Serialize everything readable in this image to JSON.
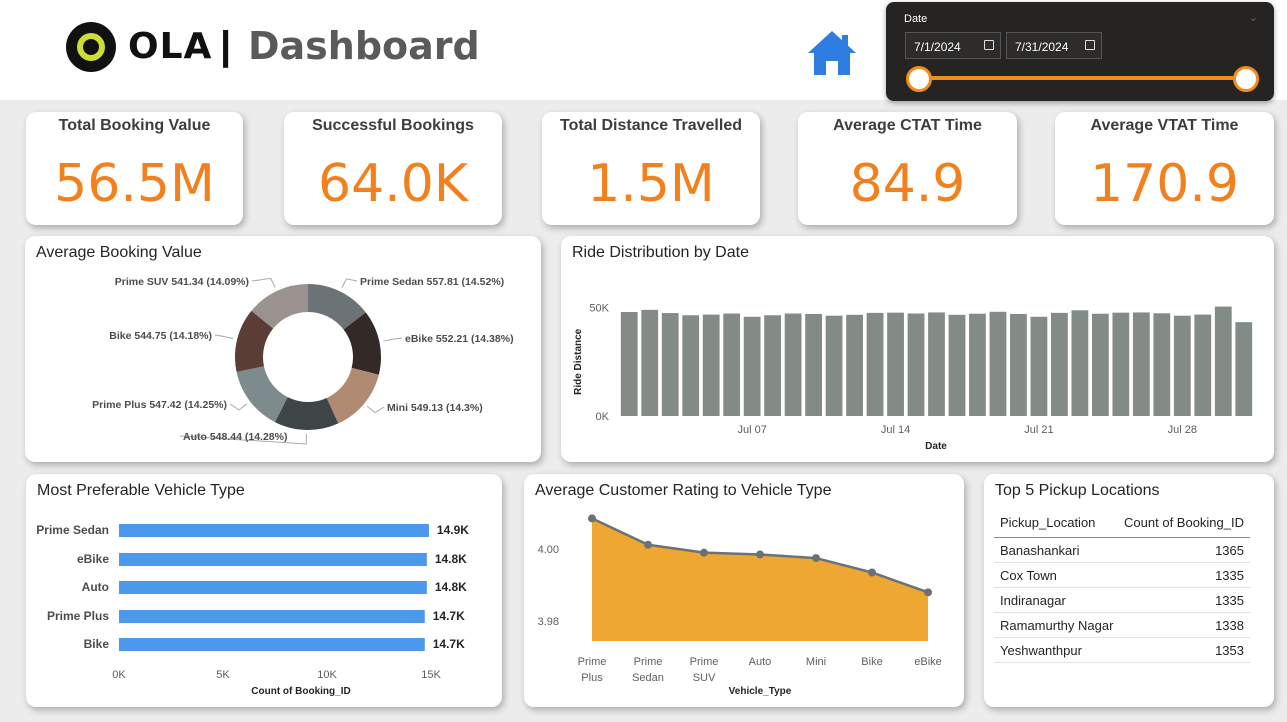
{
  "header": {
    "brand": "OLA",
    "separator": "|",
    "title": "Dashboard"
  },
  "date_filter": {
    "label": "Date",
    "start": "7/1/2024",
    "end": "7/31/2024"
  },
  "kpis": [
    {
      "label": "Total Booking Value",
      "value": "56.5M"
    },
    {
      "label": "Successful Bookings",
      "value": "64.0K"
    },
    {
      "label": "Total Distance Travelled",
      "value": "1.5M"
    },
    {
      "label": "Average CTAT Time",
      "value": "84.9"
    },
    {
      "label": "Average VTAT Time",
      "value": "170.9"
    }
  ],
  "panels": {
    "donut_title": "Average Booking Value",
    "ride_title": "Ride Distribution by Date",
    "pref_title": "Most Preferable Vehicle Type",
    "rating_title": "Average Customer Rating to Vehicle Type",
    "top5_title": "Top 5 Pickup Locations"
  },
  "top5": {
    "headers": [
      "Pickup_Location",
      "Count of Booking_ID"
    ],
    "rows": [
      [
        "Banashankari",
        "1365"
      ],
      [
        "Cox Town",
        "1335"
      ],
      [
        "Indiranagar",
        "1335"
      ],
      [
        "Ramamurthy Nagar",
        "1338"
      ],
      [
        "Yeshwanthpur",
        "1353"
      ]
    ]
  },
  "chart_data": [
    {
      "type": "pie",
      "title": "Average Booking Value",
      "categories": [
        "Prime Sedan",
        "eBike",
        "Mini",
        "Auto",
        "Prime Plus",
        "Bike",
        "Prime SUV"
      ],
      "values": [
        557.81,
        552.21,
        549.13,
        548.44,
        547.42,
        544.75,
        541.34
      ],
      "labels": [
        "Prime Sedan 557.81 (14.52%)",
        "eBike 552.21 (14.38%)",
        "Mini 549.13 (14.3%)",
        "Auto 548.44 (14.28%)",
        "Prime Plus 547.42 (14.25%)",
        "Bike 544.75 (14.18%)",
        "Prime SUV 541.34 (14.09%)"
      ],
      "colors": [
        "#6b7376",
        "#332a28",
        "#b08a72",
        "#3e4546",
        "#7d8a8e",
        "#5a3d35",
        "#9a928e"
      ]
    },
    {
      "type": "bar",
      "title": "Ride Distribution by Date",
      "xlabel": "Date",
      "ylabel": "Ride Distance",
      "ylim": [
        0,
        60000
      ],
      "yticks": [
        "0K",
        "50K"
      ],
      "xticks": [
        "Jul 07",
        "Jul 14",
        "Jul 21",
        "Jul 28"
      ],
      "x": [
        "Jul 01",
        "Jul 02",
        "Jul 03",
        "Jul 04",
        "Jul 05",
        "Jul 06",
        "Jul 07",
        "Jul 08",
        "Jul 09",
        "Jul 10",
        "Jul 11",
        "Jul 12",
        "Jul 13",
        "Jul 14",
        "Jul 15",
        "Jul 16",
        "Jul 17",
        "Jul 18",
        "Jul 19",
        "Jul 20",
        "Jul 21",
        "Jul 22",
        "Jul 23",
        "Jul 24",
        "Jul 25",
        "Jul 26",
        "Jul 27",
        "Jul 28",
        "Jul 29",
        "Jul 30",
        "Jul 31"
      ],
      "values": [
        48000,
        49000,
        47500,
        46500,
        46800,
        47300,
        45800,
        46500,
        47300,
        47100,
        46300,
        46700,
        47600,
        47700,
        47300,
        47800,
        46700,
        47200,
        48100,
        47100,
        45800,
        47600,
        48800,
        47200,
        47700,
        47800,
        47400,
        46300,
        46800,
        50500,
        43300
      ],
      "color": "#838b86"
    },
    {
      "type": "bar",
      "title": "Most Preferable Vehicle Type",
      "orientation": "horizontal",
      "xlabel": "Count of Booking_ID",
      "xlim": [
        0,
        15000
      ],
      "xticks": [
        "0K",
        "5K",
        "10K",
        "15K"
      ],
      "categories": [
        "Prime Sedan",
        "eBike",
        "Auto",
        "Prime Plus",
        "Bike"
      ],
      "values": [
        14900,
        14800,
        14800,
        14700,
        14700
      ],
      "data_labels": [
        "14.9K",
        "14.8K",
        "14.8K",
        "14.7K",
        "14.7K"
      ],
      "color": "#4b98ec"
    },
    {
      "type": "area",
      "title": "Average Customer Rating to Vehicle Type",
      "xlabel": "Vehicle_Type",
      "yticks": [
        "3.98",
        "4.00"
      ],
      "ylim": [
        3.9745,
        4.0125
      ],
      "categories": [
        "Prime Plus",
        "Prime Sedan",
        "Prime SUV",
        "Auto",
        "Mini",
        "Bike",
        "eBike"
      ],
      "values": [
        4.0085,
        4.0012,
        3.999,
        3.9985,
        3.9975,
        3.9935,
        3.988
      ],
      "fill": "#eea831",
      "line": "#6a7277"
    }
  ]
}
